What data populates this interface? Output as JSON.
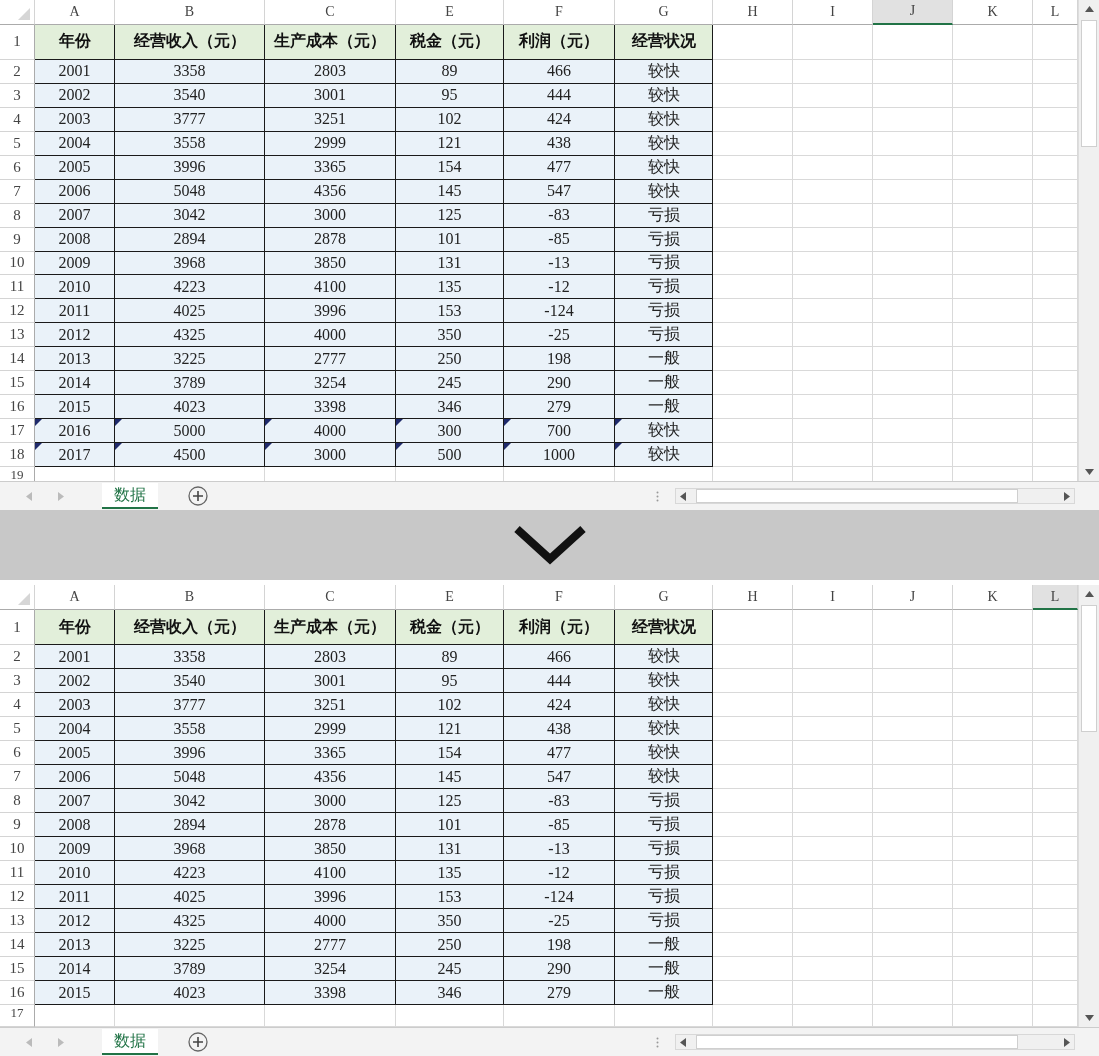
{
  "sheets": [
    {
      "columns": [
        {
          "label": "A",
          "selected": false
        },
        {
          "label": "B",
          "selected": false
        },
        {
          "label": "C",
          "selected": false
        },
        {
          "label": "E",
          "selected": false
        },
        {
          "label": "F",
          "selected": false
        },
        {
          "label": "G",
          "selected": false
        },
        {
          "label": "H",
          "selected": false
        },
        {
          "label": "I",
          "selected": false
        },
        {
          "label": "J",
          "selected": true
        },
        {
          "label": "K",
          "selected": false
        },
        {
          "label": "L",
          "selected": false
        }
      ],
      "rows": [
        {
          "kind": "header",
          "number": "1",
          "flagged": false,
          "cells": [
            "年份",
            "经营收入（元）",
            "生产成本（元）",
            "税金（元）",
            "利润（元）",
            "经营状况"
          ]
        },
        {
          "kind": "data",
          "number": "2",
          "flagged": false,
          "cells": [
            "2001",
            "3358",
            "2803",
            "89",
            "466",
            "较快"
          ]
        },
        {
          "kind": "data",
          "number": "3",
          "flagged": false,
          "cells": [
            "2002",
            "3540",
            "3001",
            "95",
            "444",
            "较快"
          ]
        },
        {
          "kind": "data",
          "number": "4",
          "flagged": false,
          "cells": [
            "2003",
            "3777",
            "3251",
            "102",
            "424",
            "较快"
          ]
        },
        {
          "kind": "data",
          "number": "5",
          "flagged": false,
          "cells": [
            "2004",
            "3558",
            "2999",
            "121",
            "438",
            "较快"
          ]
        },
        {
          "kind": "data",
          "number": "6",
          "flagged": false,
          "cells": [
            "2005",
            "3996",
            "3365",
            "154",
            "477",
            "较快"
          ]
        },
        {
          "kind": "data",
          "number": "7",
          "flagged": false,
          "cells": [
            "2006",
            "5048",
            "4356",
            "145",
            "547",
            "较快"
          ]
        },
        {
          "kind": "data",
          "number": "8",
          "flagged": false,
          "cells": [
            "2007",
            "3042",
            "3000",
            "125",
            "-83",
            "亏损"
          ]
        },
        {
          "kind": "data",
          "number": "9",
          "flagged": false,
          "cells": [
            "2008",
            "2894",
            "2878",
            "101",
            "-85",
            "亏损"
          ]
        },
        {
          "kind": "data",
          "number": "10",
          "flagged": false,
          "cells": [
            "2009",
            "3968",
            "3850",
            "131",
            "-13",
            "亏损"
          ]
        },
        {
          "kind": "data",
          "number": "11",
          "flagged": false,
          "cells": [
            "2010",
            "4223",
            "4100",
            "135",
            "-12",
            "亏损"
          ]
        },
        {
          "kind": "data",
          "number": "12",
          "flagged": false,
          "cells": [
            "2011",
            "4025",
            "3996",
            "153",
            "-124",
            "亏损"
          ]
        },
        {
          "kind": "data",
          "number": "13",
          "flagged": false,
          "cells": [
            "2012",
            "4325",
            "4000",
            "350",
            "-25",
            "亏损"
          ]
        },
        {
          "kind": "data",
          "number": "14",
          "flagged": false,
          "cells": [
            "2013",
            "3225",
            "2777",
            "250",
            "198",
            "一般"
          ]
        },
        {
          "kind": "data",
          "number": "15",
          "flagged": false,
          "cells": [
            "2014",
            "3789",
            "3254",
            "245",
            "290",
            "一般"
          ]
        },
        {
          "kind": "data",
          "number": "16",
          "flagged": false,
          "cells": [
            "2015",
            "4023",
            "3398",
            "346",
            "279",
            "一般"
          ]
        },
        {
          "kind": "data",
          "number": "17",
          "flagged": true,
          "cells": [
            "2016",
            "5000",
            "4000",
            "300",
            "700",
            "较快"
          ]
        },
        {
          "kind": "data",
          "number": "18",
          "flagged": true,
          "cells": [
            "2017",
            "4500",
            "3000",
            "500",
            "1000",
            "较快"
          ]
        },
        {
          "kind": "empty",
          "number": "19",
          "cells": []
        }
      ],
      "tab": {
        "label": "数据"
      }
    },
    {
      "columns": [
        {
          "label": "A",
          "selected": false
        },
        {
          "label": "B",
          "selected": false
        },
        {
          "label": "C",
          "selected": false
        },
        {
          "label": "E",
          "selected": false
        },
        {
          "label": "F",
          "selected": false
        },
        {
          "label": "G",
          "selected": false
        },
        {
          "label": "H",
          "selected": false
        },
        {
          "label": "I",
          "selected": false
        },
        {
          "label": "J",
          "selected": false
        },
        {
          "label": "K",
          "selected": false
        },
        {
          "label": "L",
          "selected": true
        }
      ],
      "rows": [
        {
          "kind": "header",
          "number": "1",
          "flagged": false,
          "cells": [
            "年份",
            "经营收入（元）",
            "生产成本（元）",
            "税金（元）",
            "利润（元）",
            "经营状况"
          ]
        },
        {
          "kind": "data",
          "number": "2",
          "flagged": false,
          "cells": [
            "2001",
            "3358",
            "2803",
            "89",
            "466",
            "较快"
          ]
        },
        {
          "kind": "data",
          "number": "3",
          "flagged": false,
          "cells": [
            "2002",
            "3540",
            "3001",
            "95",
            "444",
            "较快"
          ]
        },
        {
          "kind": "data",
          "number": "4",
          "flagged": false,
          "cells": [
            "2003",
            "3777",
            "3251",
            "102",
            "424",
            "较快"
          ]
        },
        {
          "kind": "data",
          "number": "5",
          "flagged": false,
          "cells": [
            "2004",
            "3558",
            "2999",
            "121",
            "438",
            "较快"
          ]
        },
        {
          "kind": "data",
          "number": "6",
          "flagged": false,
          "cells": [
            "2005",
            "3996",
            "3365",
            "154",
            "477",
            "较快"
          ]
        },
        {
          "kind": "data",
          "number": "7",
          "flagged": false,
          "cells": [
            "2006",
            "5048",
            "4356",
            "145",
            "547",
            "较快"
          ]
        },
        {
          "kind": "data",
          "number": "8",
          "flagged": false,
          "cells": [
            "2007",
            "3042",
            "3000",
            "125",
            "-83",
            "亏损"
          ]
        },
        {
          "kind": "data",
          "number": "9",
          "flagged": false,
          "cells": [
            "2008",
            "2894",
            "2878",
            "101",
            "-85",
            "亏损"
          ]
        },
        {
          "kind": "data",
          "number": "10",
          "flagged": false,
          "cells": [
            "2009",
            "3968",
            "3850",
            "131",
            "-13",
            "亏损"
          ]
        },
        {
          "kind": "data",
          "number": "11",
          "flagged": false,
          "cells": [
            "2010",
            "4223",
            "4100",
            "135",
            "-12",
            "亏损"
          ]
        },
        {
          "kind": "data",
          "number": "12",
          "flagged": false,
          "cells": [
            "2011",
            "4025",
            "3996",
            "153",
            "-124",
            "亏损"
          ]
        },
        {
          "kind": "data",
          "number": "13",
          "flagged": false,
          "cells": [
            "2012",
            "4325",
            "4000",
            "350",
            "-25",
            "亏损"
          ]
        },
        {
          "kind": "data",
          "number": "14",
          "flagged": false,
          "cells": [
            "2013",
            "3225",
            "2777",
            "250",
            "198",
            "一般"
          ]
        },
        {
          "kind": "data",
          "number": "15",
          "flagged": false,
          "cells": [
            "2014",
            "3789",
            "3254",
            "245",
            "290",
            "一般"
          ]
        },
        {
          "kind": "data",
          "number": "16",
          "flagged": false,
          "cells": [
            "2015",
            "4023",
            "3398",
            "346",
            "279",
            "一般"
          ]
        },
        {
          "kind": "empty",
          "number": "17",
          "cells": []
        }
      ],
      "tab": {
        "label": "数据"
      }
    }
  ]
}
